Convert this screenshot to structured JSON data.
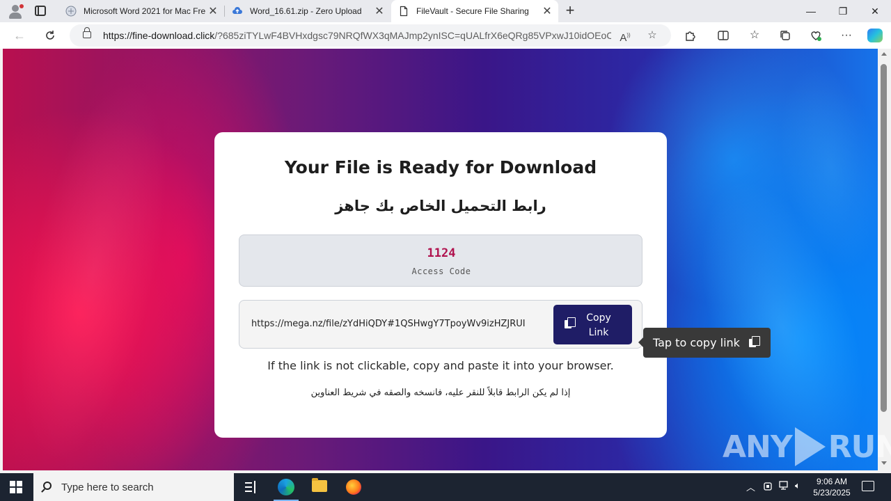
{
  "browser": {
    "tabs": [
      {
        "title": "Microsoft Word 2021 for Mac Fre",
        "close": "✕"
      },
      {
        "title": "Word_16.61.zip - Zero Upload",
        "close": "✕"
      },
      {
        "title": "FileVault - Secure File Sharing",
        "close": "✕"
      }
    ],
    "new_tab": "+",
    "window_controls": {
      "minimize": "—",
      "restore": "❐",
      "close": "✕"
    },
    "url_host": "https://fine-download.click",
    "url_rest": "/?685ziTYLwF4BVHxdgsc79NRQfWX3qMAJmp2ynISC=qUALfrX6eQRg85VPxwJ10idOEoCs...",
    "icons": [
      "read-aloud-icon",
      "favorite-star-icon",
      "extensions-icon",
      "split-screen-icon",
      "favorites-icon",
      "collections-icon",
      "browser-essentials-icon",
      "more-icon",
      "copilot-icon"
    ]
  },
  "page": {
    "title": "Your File is Ready for Download",
    "title_ar": "رابط التحميل الخاص بك جاهز",
    "access_code": "1124",
    "access_code_label": "Access Code",
    "link": "https://mega.nz/file/zYdHiQDY#1QSHwgY7TpoyWv9izHZJRUI",
    "copy_button": "Copy Link",
    "note_en": "If the link is not clickable, copy and paste it into your browser.",
    "note_ar": "إذا لم يكن الرابط قابلاً للنقر عليه، فانسخه والصقه في شريط العناوين",
    "tooltip": "Tap to copy link",
    "watermark_left": "ANY",
    "watermark_right": "RUN"
  },
  "taskbar": {
    "search_placeholder": "Type here to search",
    "time": "9:06 AM",
    "date": "5/23/2025"
  },
  "colors": {
    "accent_button": "#1f1d66",
    "access_code": "#b0124e",
    "tooltip_bg": "#393939"
  }
}
